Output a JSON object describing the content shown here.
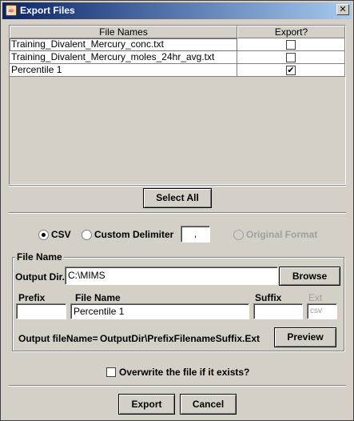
{
  "window": {
    "title": "Export Files",
    "close_label": "✕"
  },
  "table": {
    "columns": [
      "File Names",
      "Export?"
    ],
    "rows": [
      {
        "name": "Training_Divalent_Mercury_conc.txt",
        "export": ""
      },
      {
        "name": "Training_Divalent_Mercury_moles_24hr_avg.txt",
        "export": ""
      },
      {
        "name": "Percentile 1",
        "export": "✔"
      }
    ]
  },
  "select_all_label": "Select All",
  "format": {
    "csv_label": "CSV",
    "custom_label": "Custom Delimiter",
    "delimiter_value": ",",
    "original_label": "Original Format",
    "selected": "CSV"
  },
  "file_name": {
    "group_title": "File Name",
    "output_dir_label": "Output Dir.",
    "output_dir_value": "C:\\MIMS",
    "browse_label": "Browse",
    "prefix_label": "Prefix",
    "prefix_value": "",
    "file_name_label": "File Name",
    "file_name_value": "Percentile 1",
    "suffix_label": "Suffix",
    "suffix_value": "",
    "ext_label": "Ext",
    "ext_value": "csv",
    "output_filename_label": "Output fileName=",
    "output_filename_value": "OutputDir\\PrefixFilenameSuffix.Ext",
    "preview_label": "Preview"
  },
  "overwrite_label": "Overwrite the file if it exists?",
  "footer": {
    "export_label": "Export",
    "cancel_label": "Cancel"
  }
}
